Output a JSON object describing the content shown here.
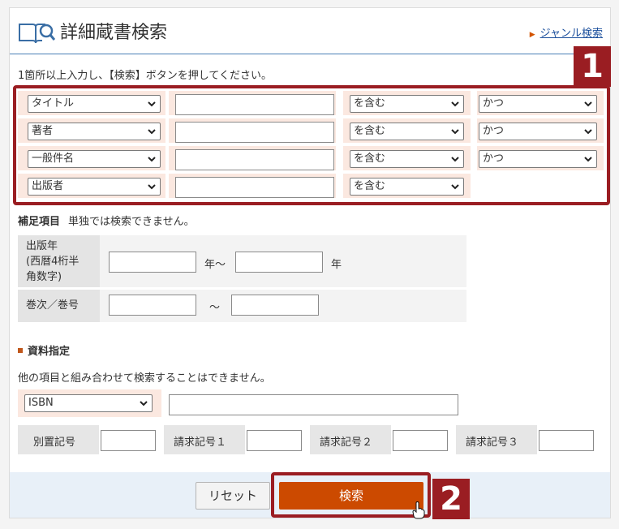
{
  "header": {
    "title": "詳細蔵書検索",
    "genre_link": "ジャンル検索"
  },
  "instruction": "1箇所以上入力し、【検索】ボタンを押してください。",
  "conditions": [
    {
      "field": "タイトル",
      "match": "を含む",
      "logic": "かつ"
    },
    {
      "field": "著者",
      "match": "を含む",
      "logic": "かつ"
    },
    {
      "field": "一般件名",
      "match": "を含む",
      "logic": "かつ"
    },
    {
      "field": "出版者",
      "match": "を含む"
    }
  ],
  "supplementary": {
    "label": "補足項目",
    "note": "単独では検索できません。",
    "pub_year_label": "出版年\n(西暦4桁半\n角数字)",
    "year_unit_from": "年〜",
    "year_unit_to": "年",
    "volume_label": "巻次／巻号",
    "range_sep": "〜"
  },
  "material": {
    "title": "資料指定",
    "note": "他の項目と組み合わせて検索することはできません。",
    "isbn_select": "ISBN"
  },
  "call_numbers": {
    "separate": "別置記号",
    "call1": "請求記号１",
    "call2": "請求記号２",
    "call3": "請求記号３"
  },
  "buttons": {
    "reset": "リセット",
    "search": "検索"
  },
  "badges": {
    "one": "1",
    "two": "2"
  },
  "colors": {
    "accent_red": "#9a1d22",
    "search_button": "#cc4a00",
    "condition_bg": "#fbe8e0",
    "link": "#1a4e9c"
  }
}
